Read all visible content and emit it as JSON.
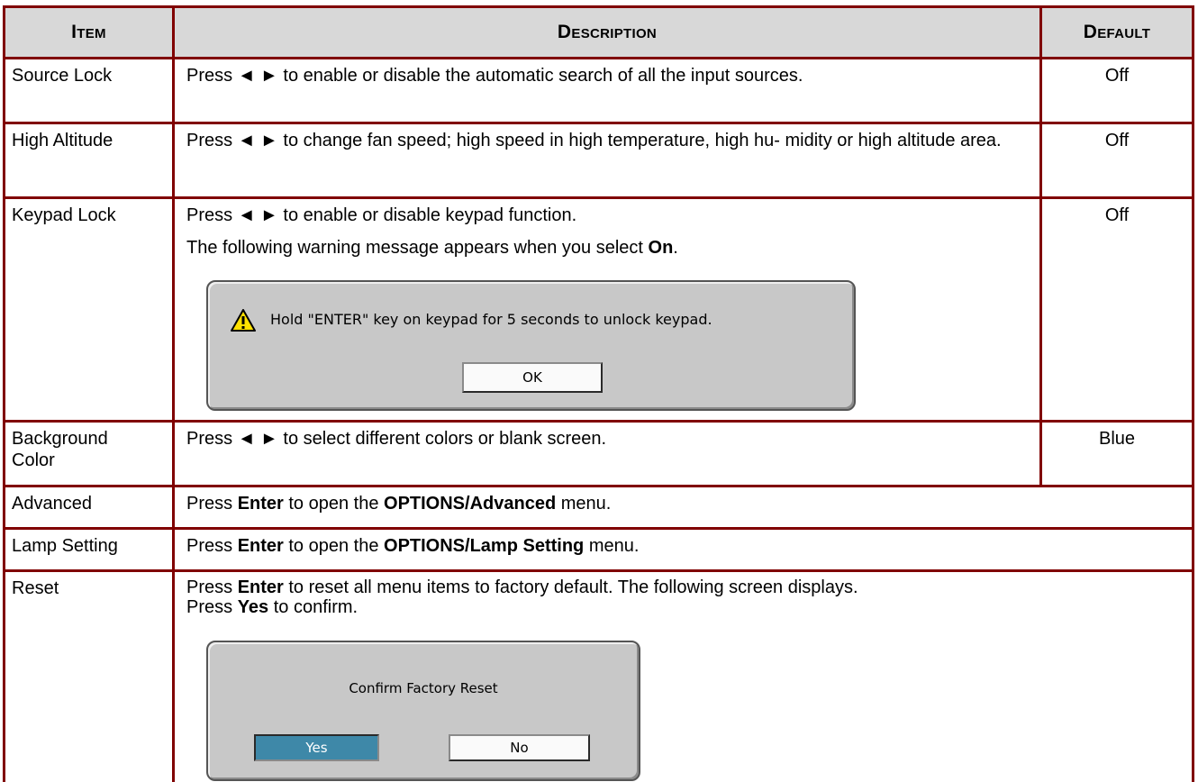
{
  "headers": {
    "item": "Item",
    "description": "Description",
    "default": "Default"
  },
  "rows": [
    {
      "item": "Source Lock",
      "desc_pre": "Press ",
      "arrows": "◄ ►",
      "desc_post": " to enable or disable the automatic search of all the input sources.",
      "default": "Off"
    },
    {
      "item": "High Altitude",
      "desc_pre": "Press ",
      "arrows": "◄ ►",
      "desc_post": " to change fan speed; high speed in high temperature, high hu- midity or high altitude area.",
      "default": "Off"
    },
    {
      "item": "Keypad Lock",
      "desc_pre": "Press ",
      "arrows": "◄ ►",
      "desc_post": " to enable or disable keypad function.",
      "note_pre": "The following warning message appears when you select ",
      "note_bold": "On",
      "note_post": ".",
      "default": "Off"
    },
    {
      "item_line1": "Background",
      "item_line2": "Color",
      "desc_pre": "Press ",
      "arrows": "◄ ►",
      "desc_post": " to select different colors or blank screen.",
      "default": "Blue"
    },
    {
      "item": "Advanced",
      "desc_pre": "Press ",
      "desc_bold1": "Enter",
      "desc_mid": " to open the ",
      "desc_bold2": "OPTIONS/Advanced",
      "desc_post": " menu."
    },
    {
      "item": "Lamp Setting",
      "desc_pre": "Press ",
      "desc_bold1": "Enter",
      "desc_mid": " to open the ",
      "desc_bold2": "OPTIONS/Lamp Setting",
      "desc_post": " menu."
    },
    {
      "item": "Reset",
      "desc_pre": "Press ",
      "desc_bold1": "Enter",
      "desc_mid": " to reset all menu items to factory default. The following screen displays.",
      "line2_pre": "Press ",
      "line2_bold": "Yes",
      "line2_post": " to confirm."
    }
  ],
  "keypad_dialog": {
    "message": "Hold \"ENTER\" key on keypad for 5 seconds to unlock keypad.",
    "ok_label": "OK"
  },
  "reset_dialog": {
    "title": "Confirm Factory Reset",
    "yes_label": "Yes",
    "no_label": "No"
  },
  "colors": {
    "border": "#800000",
    "header_bg": "#d8d8d8",
    "dialog_bg": "#c8c8c8",
    "selected_button": "#3e88a8",
    "warning_yellow": "#ffe000"
  }
}
